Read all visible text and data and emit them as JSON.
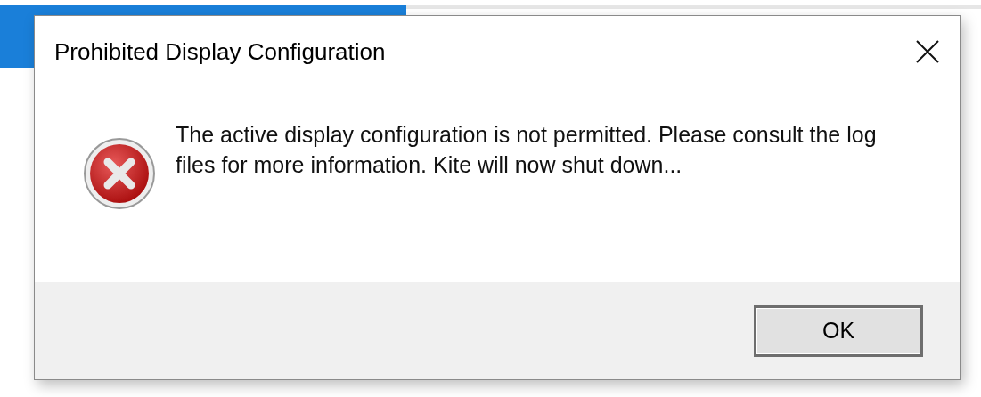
{
  "dialog": {
    "title": "Prohibited Display Configuration",
    "message": "The active display configuration is not permitted. Please consult the log files for more information. Kite will now shut down...",
    "buttons": [
      {
        "label": "OK",
        "default": true
      }
    ]
  }
}
